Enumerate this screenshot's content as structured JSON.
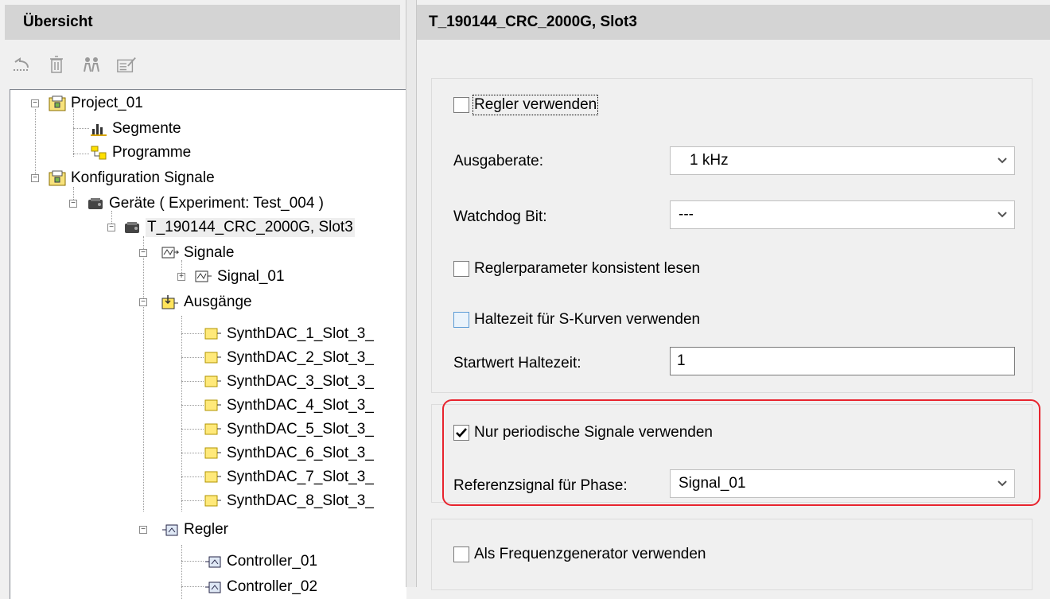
{
  "left_panel": {
    "title": "Übersicht",
    "toolbar": [
      "undo-icon",
      "trash-icon",
      "users-icon",
      "properties-icon"
    ],
    "tree": [
      {
        "id": "project",
        "label": "Project_01",
        "icon": "project-folder-icon"
      },
      {
        "id": "segmente",
        "label": "Segmente",
        "icon": "bar-chart-icon"
      },
      {
        "id": "programme",
        "label": "Programme",
        "icon": "program-icon"
      },
      {
        "id": "konfig",
        "label": "Konfiguration Signale",
        "icon": "project-folder-icon"
      },
      {
        "id": "geraete",
        "label": "Geräte ( Experiment: Test_004 )",
        "icon": "device-icon"
      },
      {
        "id": "device",
        "label": "T_190144_CRC_2000G, Slot3",
        "icon": "device-icon"
      },
      {
        "id": "signale",
        "label": "Signale",
        "icon": "signal-group-icon"
      },
      {
        "id": "signal01",
        "label": "Signal_01",
        "icon": "signal-icon"
      },
      {
        "id": "ausgaenge",
        "label": "Ausgänge",
        "icon": "output-group-icon"
      },
      {
        "id": "out1",
        "label": "SynthDAC_1_Slot_3_",
        "icon": "output-icon"
      },
      {
        "id": "out2",
        "label": "SynthDAC_2_Slot_3_",
        "icon": "output-icon"
      },
      {
        "id": "out3",
        "label": "SynthDAC_3_Slot_3_",
        "icon": "output-icon"
      },
      {
        "id": "out4",
        "label": "SynthDAC_4_Slot_3_",
        "icon": "output-icon"
      },
      {
        "id": "out5",
        "label": "SynthDAC_5_Slot_3_",
        "icon": "output-icon"
      },
      {
        "id": "out6",
        "label": "SynthDAC_6_Slot_3_",
        "icon": "output-icon"
      },
      {
        "id": "out7",
        "label": "SynthDAC_7_Slot_3_",
        "icon": "output-icon"
      },
      {
        "id": "out8",
        "label": "SynthDAC_8_Slot_3_",
        "icon": "output-icon"
      },
      {
        "id": "regler",
        "label": "Regler",
        "icon": "controller-group-icon"
      },
      {
        "id": "ctrl1",
        "label": "Controller_01",
        "icon": "controller-icon"
      },
      {
        "id": "ctrl2",
        "label": "Controller_02",
        "icon": "controller-icon"
      }
    ]
  },
  "right_panel": {
    "title": "T_190144_CRC_2000G, Slot3",
    "regler_verwenden": {
      "label": "Regler verwenden",
      "checked": false
    },
    "ausgaberate": {
      "label": "Ausgaberate:",
      "value": "1 kHz"
    },
    "watchdog": {
      "label": "Watchdog Bit:",
      "value": "---"
    },
    "konsistent": {
      "label": "Reglerparameter konsistent lesen",
      "checked": false
    },
    "haltezeit": {
      "label": "Haltezeit für S-Kurven verwenden",
      "checked": false
    },
    "startwert": {
      "label": "Startwert Haltezeit:",
      "value": "1"
    },
    "periodisch": {
      "label": "Nur periodische Signale verwenden",
      "checked": true
    },
    "referenz": {
      "label": "Referenzsignal für Phase:",
      "value": "Signal_01"
    },
    "frequenz": {
      "label": "Als Frequenzgenerator verwenden",
      "checked": false
    }
  }
}
